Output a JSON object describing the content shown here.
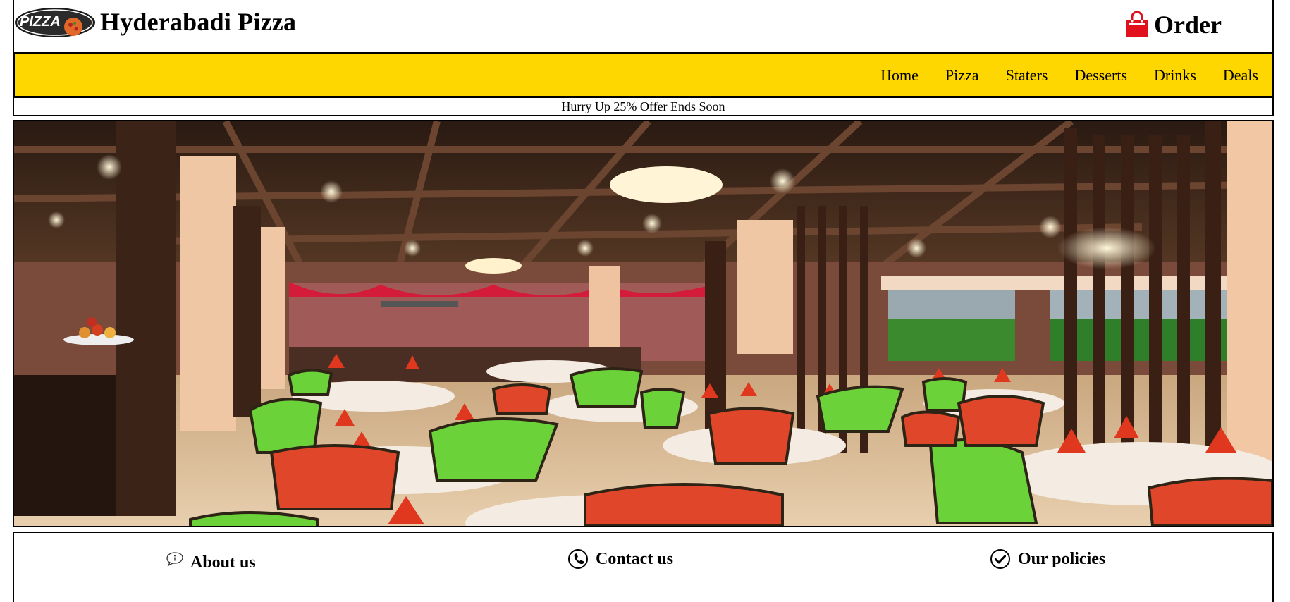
{
  "header": {
    "logo_text": "PIZZA",
    "site_title": "Hyderabadi Pizza",
    "order_label": "Order",
    "order_icon": "shopping-bag-icon"
  },
  "nav": {
    "items": [
      {
        "label": "Home"
      },
      {
        "label": "Pizza"
      },
      {
        "label": "Staters"
      },
      {
        "label": "Desserts"
      },
      {
        "label": "Drinks"
      },
      {
        "label": "Deals"
      }
    ]
  },
  "offer": {
    "text": "Hurry Up 25% Offer Ends Soon"
  },
  "hero": {
    "image": "restaurant-interior"
  },
  "footer": {
    "about": {
      "label": "About us",
      "icon": "info-icon"
    },
    "contact": {
      "label": "Contact us",
      "icon": "phone-icon"
    },
    "policies": {
      "label": "Our policies",
      "icon": "check-circle-icon"
    }
  },
  "colors": {
    "nav_background": "#ffd700",
    "order_icon": "#e0101c",
    "border": "#000000"
  }
}
